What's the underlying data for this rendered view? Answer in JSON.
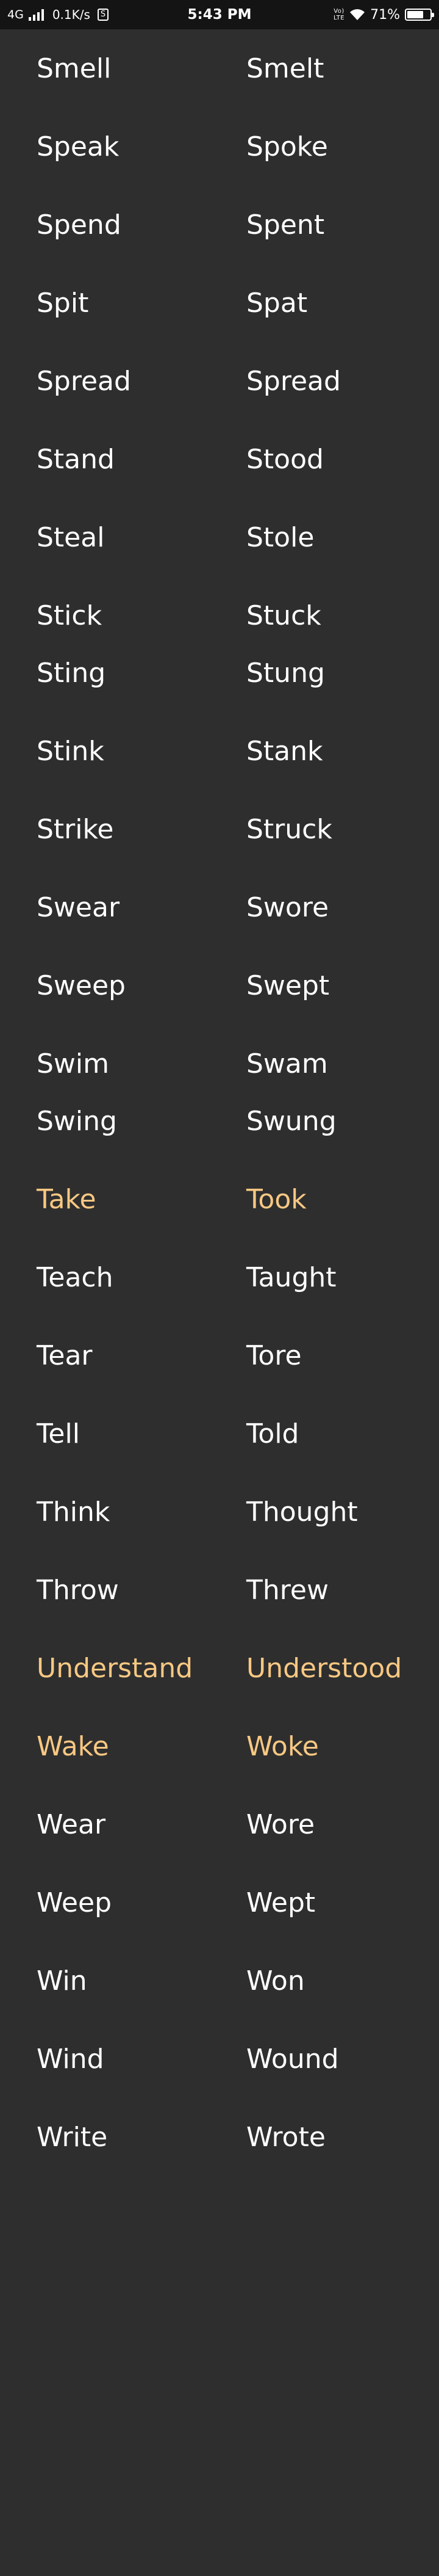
{
  "status_bar": {
    "network": "4G",
    "speed": "0.1K/s",
    "sim_badge": "S",
    "time": "5:43 PM",
    "volte_top": "Vo)",
    "volte_bottom": "LTE",
    "battery_text": "71%",
    "battery_level": 0.71
  },
  "colors": {
    "background": "#2e2e2e",
    "status_bar": "#141414",
    "text": "#ffffff",
    "highlight": "#f8c883"
  },
  "verbs": [
    {
      "base": "Smell",
      "past": "Smelt",
      "highlight": false
    },
    {
      "base": "Speak",
      "past": "Spoke",
      "highlight": false
    },
    {
      "base": "Spend",
      "past": "Spent",
      "highlight": false
    },
    {
      "base": "Spit",
      "past": "Spat",
      "highlight": false
    },
    {
      "base": "Spread",
      "past": "Spread",
      "highlight": false
    },
    {
      "base": "Stand",
      "past": "Stood",
      "highlight": false
    },
    {
      "base": "Steal",
      "past": "Stole",
      "highlight": false
    },
    {
      "base": "Stick",
      "past": "Stuck",
      "highlight": false
    },
    {
      "base": "Sting",
      "past": "Stung",
      "highlight": false
    },
    {
      "base": "Stink",
      "past": "Stank",
      "highlight": false
    },
    {
      "base": "Strike",
      "past": "Struck",
      "highlight": false
    },
    {
      "base": "Swear",
      "past": "Swore",
      "highlight": false
    },
    {
      "base": "Sweep",
      "past": "Swept",
      "highlight": false
    },
    {
      "base": "Swim",
      "past": "Swam",
      "highlight": false
    },
    {
      "base": "Swing",
      "past": "Swung",
      "highlight": false
    },
    {
      "base": "Take",
      "past": "Took",
      "highlight": true
    },
    {
      "base": "Teach",
      "past": "Taught",
      "highlight": false
    },
    {
      "base": "Tear",
      "past": "Tore",
      "highlight": false
    },
    {
      "base": "Tell",
      "past": "Told",
      "highlight": false
    },
    {
      "base": "Think",
      "past": "Thought",
      "highlight": false
    },
    {
      "base": "Throw",
      "past": "Threw",
      "highlight": false
    },
    {
      "base": "Understand",
      "past": "Understood",
      "highlight": true
    },
    {
      "base": "Wake",
      "past": "Woke",
      "highlight": true
    },
    {
      "base": "Wear",
      "past": "Wore",
      "highlight": false
    },
    {
      "base": "Weep",
      "past": "Wept",
      "highlight": false
    },
    {
      "base": "Win",
      "past": "Won",
      "highlight": false
    },
    {
      "base": "Wind",
      "past": "Wound",
      "highlight": false
    },
    {
      "base": "Write",
      "past": "Wrote",
      "highlight": false
    }
  ]
}
